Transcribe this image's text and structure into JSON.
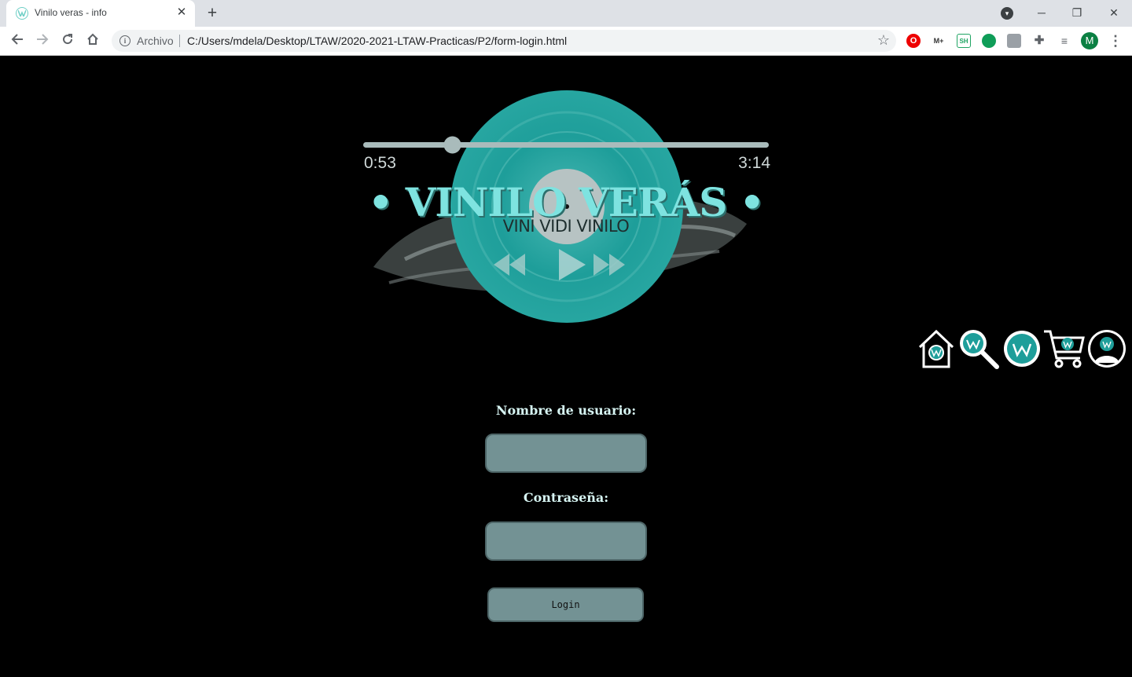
{
  "browser": {
    "tab_title": "Vinilo veras - info",
    "new_tab_label": "+",
    "close_tab_label": "✕",
    "window_controls": {
      "minimize": "─",
      "maximize": "❐",
      "close": "✕"
    },
    "security_label": "Archivo",
    "url": "C:/Users/mdela/Desktop/LTAW/2020-2021-LTAW-Practicas/P2/form-login.html",
    "avatar_initial": "M",
    "extensions": [
      "opera-icon",
      "movistar-icon",
      "sheets-icon",
      "green-bubble-icon",
      "photo-icon",
      "puzzle-icon",
      "media-icon"
    ]
  },
  "player": {
    "time_elapsed": "0:53",
    "time_total": "3:14",
    "progress": 0.22
  },
  "brand": {
    "title": "• VINILO VERÁS •",
    "slogan": "VINI VIDI VINILO"
  },
  "nav": {
    "items": [
      "home-icon",
      "search-icon",
      "logo-icon",
      "cart-icon",
      "user-icon"
    ]
  },
  "form": {
    "username_label": "Nombre de usuario:",
    "username_value": "",
    "password_label": "Contraseña:",
    "password_value": "",
    "login_label": "Login"
  },
  "colors": {
    "accent": "#7ee3e0",
    "disc": "#1e9e9a",
    "field": "#739294",
    "background": "#000000"
  }
}
